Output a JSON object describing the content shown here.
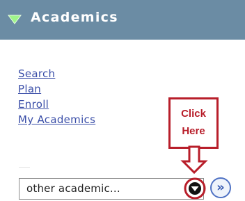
{
  "header": {
    "title": "Academics",
    "icon": "triangle-down-icon"
  },
  "links": [
    {
      "label": "Search"
    },
    {
      "label": "Plan"
    },
    {
      "label": "Enroll"
    },
    {
      "label": "My Academics"
    }
  ],
  "select": {
    "value": "other academic...",
    "dropdown_icon": "chevron-down-icon"
  },
  "go_button": {
    "glyph": "»",
    "icon": "double-chevron-right-icon"
  },
  "annotation": {
    "line1": "Click",
    "line2": "Here",
    "color": "#b81e2a"
  },
  "colors": {
    "header_bg": "#6b8ca4",
    "link": "#3a4ea8",
    "accent": "#b81e2a"
  }
}
